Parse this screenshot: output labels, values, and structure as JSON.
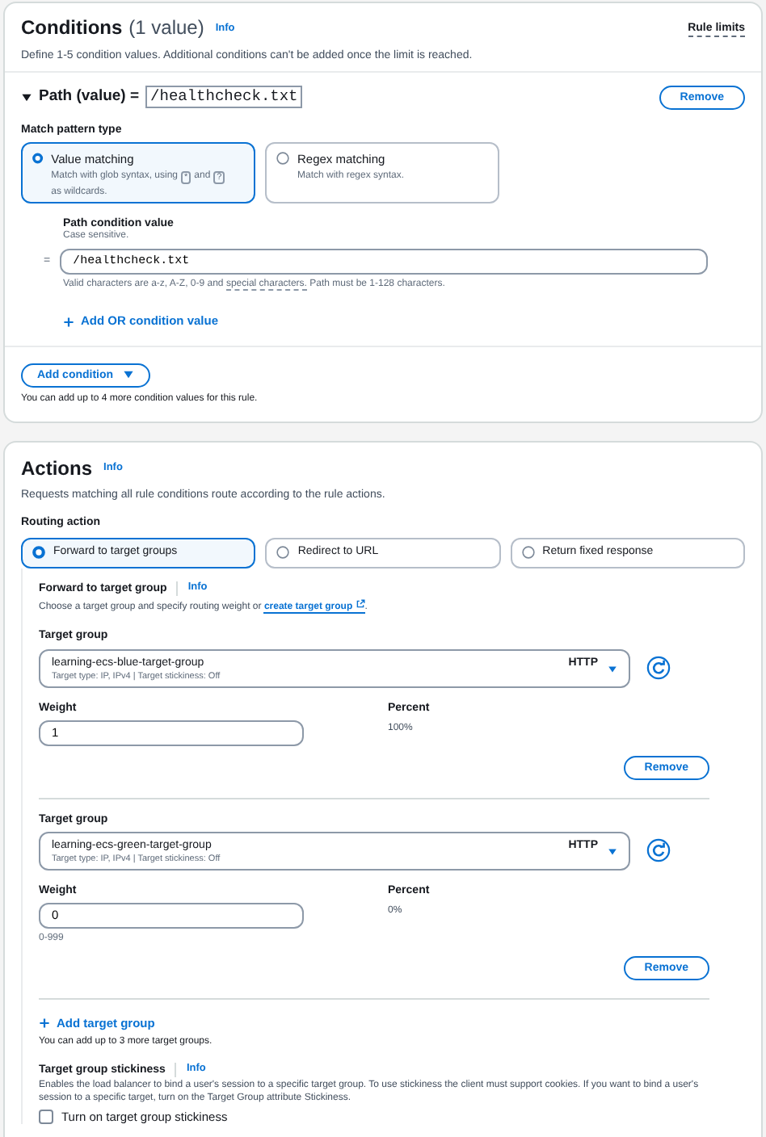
{
  "conditions": {
    "title": "Conditions",
    "count": "(1 value)",
    "info": "Info",
    "rule_limits": "Rule limits",
    "description": "Define 1-5 condition values. Additional conditions can't be added once the limit is reached.",
    "condition": {
      "expanded": true,
      "label": "Path (value) =",
      "value": "/healthcheck.txt",
      "remove": "Remove",
      "match_type_label": "Match pattern type",
      "options": [
        {
          "title": "Value matching",
          "selected": true,
          "description": [
            {
              "kind": "text",
              "text": "Match with glob syntax, using"
            },
            {
              "kind": "key",
              "text": "*"
            },
            {
              "kind": "text",
              "text": "and"
            },
            {
              "kind": "key",
              "text": "?"
            },
            {
              "kind": "text",
              "text": "as wildcards."
            }
          ]
        },
        {
          "title": "Regex matching",
          "selected": false,
          "description": [
            {
              "kind": "text",
              "text": "Match with regex syntax."
            }
          ]
        }
      ],
      "value_label": "Path condition value",
      "value_hint": "Case sensitive.",
      "or_marker": "=",
      "input_value": "/healthcheck.txt",
      "help": [
        {
          "kind": "text",
          "text": "Valid characters are a-z, A-Z, 0-9 and"
        },
        {
          "kind": "term",
          "text": "special characters."
        },
        {
          "kind": "text",
          "text": "Path must be 1-128 characters."
        }
      ],
      "add_or": "Add OR condition value"
    },
    "add_condition": "Add condition",
    "add_note": "You can add up to 4 more condition values for this rule."
  },
  "actions": {
    "title": "Actions",
    "info": "Info",
    "description": "Requests matching all rule conditions route according to the rule actions.",
    "routing_label": "Routing action",
    "routing_options": [
      {
        "label": "Forward to target groups",
        "selected": true
      },
      {
        "label": "Redirect to URL",
        "selected": false
      },
      {
        "label": "Return fixed response",
        "selected": false
      }
    ],
    "forward": {
      "title": "Forward to target group",
      "info": "Info",
      "description": "Choose a target group and specify routing weight or",
      "link": "create target group",
      "link_end": ".",
      "target_groups": [
        {
          "label": "Target group",
          "name": "learning-ecs-blue-target-group",
          "details": "Target type: IP, IPv4 | Target stickiness: Off",
          "protocol": "HTTP",
          "weight_label": "Weight",
          "weight": "1",
          "percent_label": "Percent",
          "percent": "100%",
          "remove": "Remove"
        },
        {
          "label": "Target group",
          "name": "learning-ecs-green-target-group",
          "details": "Target type: IP, IPv4 | Target stickiness: Off",
          "protocol": "HTTP",
          "weight_label": "Weight",
          "weight": "0",
          "weight_hint": "0-999",
          "percent_label": "Percent",
          "percent": "0%",
          "remove": "Remove"
        }
      ],
      "add_target_group": "Add target group",
      "add_note": "You can add up to 3 more target groups.",
      "stickiness": {
        "title": "Target group stickiness",
        "info": "Info",
        "description": "Enables the load balancer to bind a user's session to a specific target group. To use stickiness the client must support cookies. If you want to bind a user's session to a specific target, turn on the Target Group attribute Stickiness.",
        "checkbox_label": "Turn on target group stickiness",
        "checked": false
      }
    }
  }
}
